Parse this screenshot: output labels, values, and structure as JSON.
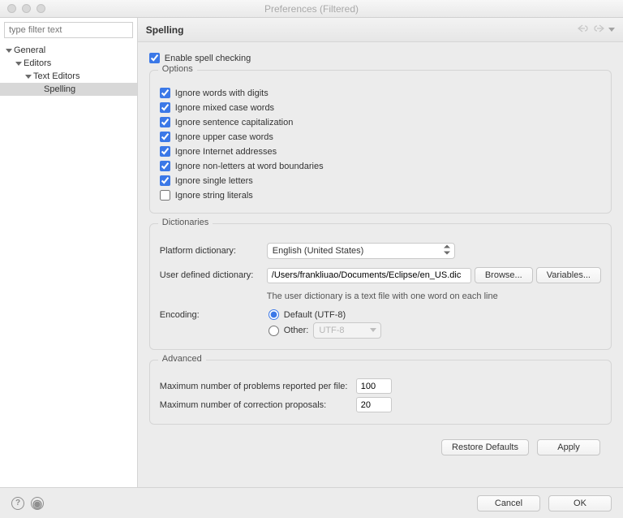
{
  "window": {
    "title": "Preferences (Filtered)"
  },
  "filter": {
    "placeholder": "type filter text"
  },
  "tree": {
    "general": "General",
    "editors": "Editors",
    "textEditors": "Text Editors",
    "spelling": "Spelling"
  },
  "header": {
    "title": "Spelling"
  },
  "enable": {
    "label": "Enable spell checking",
    "checked": true
  },
  "options": {
    "legend": "Options",
    "items": [
      {
        "label": "Ignore words with digits",
        "checked": true
      },
      {
        "label": "Ignore mixed case words",
        "checked": true
      },
      {
        "label": "Ignore sentence capitalization",
        "checked": true
      },
      {
        "label": "Ignore upper case words",
        "checked": true
      },
      {
        "label": "Ignore Internet addresses",
        "checked": true
      },
      {
        "label": "Ignore non-letters at word boundaries",
        "checked": true
      },
      {
        "label": "Ignore single letters",
        "checked": true
      },
      {
        "label": "Ignore string literals",
        "checked": false
      }
    ]
  },
  "dict": {
    "legend": "Dictionaries",
    "platform_label": "Platform dictionary:",
    "platform_value": "English (United States)",
    "user_label": "User defined dictionary:",
    "user_value": "/Users/frankliuao/Documents/Eclipse/en_US.dic",
    "browse": "Browse...",
    "variables": "Variables...",
    "hint": "The user dictionary is a text file with one word on each line",
    "encoding_label": "Encoding:",
    "encoding_default": "Default (UTF-8)",
    "encoding_other": "Other:",
    "encoding_other_value": "UTF-8"
  },
  "advanced": {
    "legend": "Advanced",
    "maxProblems_label": "Maximum number of problems reported per file:",
    "maxProblems_value": "100",
    "maxProposals_label": "Maximum number of correction proposals:",
    "maxProposals_value": "20"
  },
  "buttons": {
    "restore": "Restore Defaults",
    "apply": "Apply",
    "cancel": "Cancel",
    "ok": "OK"
  }
}
